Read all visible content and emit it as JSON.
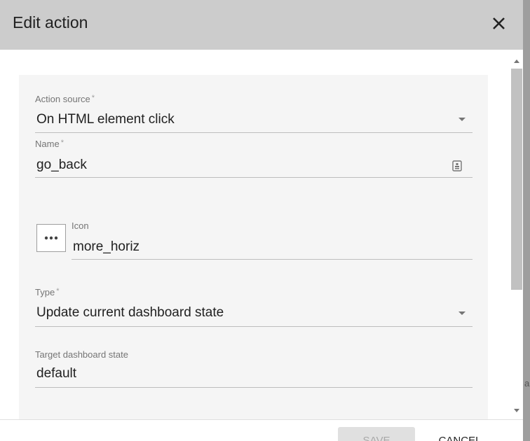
{
  "dialog": {
    "title": "Edit action",
    "close_icon": "close-icon"
  },
  "form": {
    "action_source": {
      "label": "Action source",
      "required_mark": "*",
      "value": "On HTML element click"
    },
    "name": {
      "label": "Name",
      "required_mark": "*",
      "value": "go_back",
      "suffix_icon": "variable-picker-icon"
    },
    "icon": {
      "label": "Icon",
      "value": "more_horiz",
      "preview_icon": "more-horiz-icon"
    },
    "type": {
      "label": "Type",
      "required_mark": "*",
      "value": "Update current dashboard state"
    },
    "target_state": {
      "label": "Target dashboard state",
      "value": "default"
    }
  },
  "footer": {
    "save_label": "SAVE",
    "cancel_label": "CANCEL"
  },
  "background_fragment": "a",
  "colors": {
    "header_bg": "#cccccc",
    "panel_bg": "#f5f5f5",
    "save_disabled_bg": "#e0e0e0"
  }
}
